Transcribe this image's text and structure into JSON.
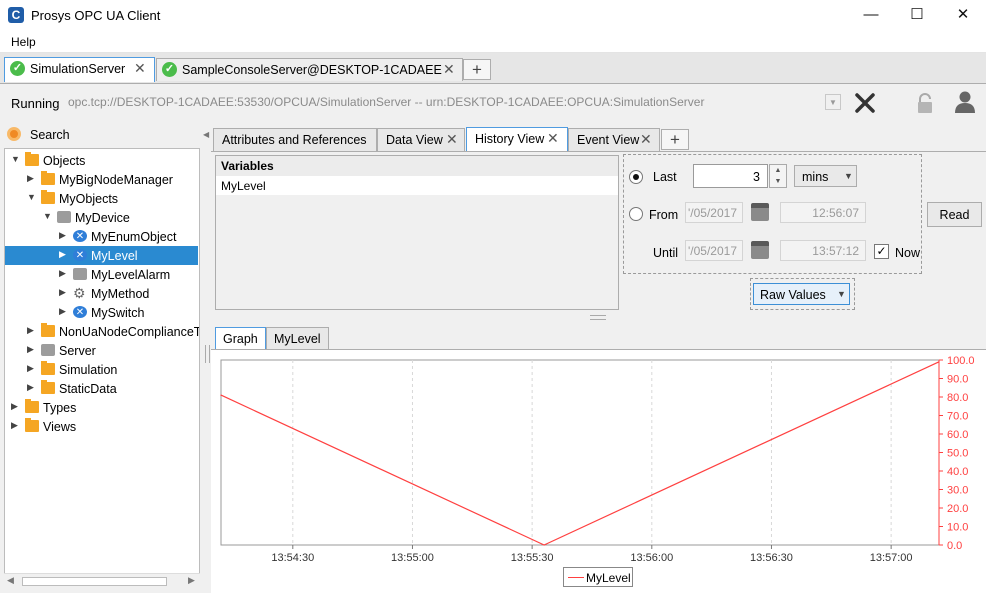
{
  "window": {
    "title": "Prosys OPC UA Client",
    "app_icon": "C",
    "minimize": "—",
    "maximize": "☐",
    "close": "✕"
  },
  "menu": {
    "help": "Help"
  },
  "server_tabs": [
    {
      "label": "SimulationServer",
      "active": true
    },
    {
      "label": "SampleConsoleServer@DESKTOP-1CADAEE",
      "active": false
    }
  ],
  "status": {
    "running": "Running",
    "url": "opc.tcp://DESKTOP-1CADAEE:53530/OPCUA/SimulationServer -- urn:DESKTOP-1CADAEE:OPCUA:SimulationServer"
  },
  "search": {
    "label": "Search"
  },
  "tree": [
    {
      "label": "Objects",
      "icon": "folder-icon",
      "arrow": "▼",
      "level": 0
    },
    {
      "label": "MyBigNodeManager",
      "icon": "folder-icon",
      "arrow": "▶",
      "level": 1
    },
    {
      "label": "MyObjects",
      "icon": "folder-icon",
      "arrow": "▼",
      "level": 1
    },
    {
      "label": "MyDevice",
      "icon": "object-icon",
      "arrow": "▼",
      "level": 2
    },
    {
      "label": "MyEnumObject",
      "icon": "variable-icon",
      "arrow": "▶",
      "level": 3
    },
    {
      "label": "MyLevel",
      "icon": "variable-icon",
      "arrow": "▶",
      "level": 3,
      "selected": true
    },
    {
      "label": "MyLevelAlarm",
      "icon": "object-icon",
      "arrow": "▶",
      "level": 3
    },
    {
      "label": "MyMethod",
      "icon": "gear-icon",
      "arrow": "▶",
      "level": 3
    },
    {
      "label": "MySwitch",
      "icon": "variable-icon",
      "arrow": "▶",
      "level": 3
    },
    {
      "label": "NonUaNodeComplianceT",
      "icon": "folder-icon",
      "arrow": "▶",
      "level": 1
    },
    {
      "label": "Server",
      "icon": "object-icon",
      "arrow": "▶",
      "level": 1
    },
    {
      "label": "Simulation",
      "icon": "folder-icon",
      "arrow": "▶",
      "level": 1
    },
    {
      "label": "StaticData",
      "icon": "folder-icon",
      "arrow": "▶",
      "level": 1
    },
    {
      "label": "Types",
      "icon": "folder-icon",
      "arrow": "▶",
      "level": 0
    },
    {
      "label": "Views",
      "icon": "folder-icon",
      "arrow": "▶",
      "level": 0
    }
  ],
  "view_tabs": [
    {
      "label": "Attributes and References",
      "closable": false
    },
    {
      "label": "Data View",
      "closable": true
    },
    {
      "label": "History View",
      "closable": true,
      "active": true
    },
    {
      "label": "Event View",
      "closable": true
    }
  ],
  "variables": {
    "header": "Variables",
    "rows": [
      "MyLevel"
    ]
  },
  "history": {
    "last_label": "Last",
    "last_value": "3",
    "unit": "mins",
    "from_label": "From",
    "from_date": "'/05/2017",
    "from_time": "12:56:07",
    "until_label": "Until",
    "until_date": "'/05/2017",
    "until_time": "13:57:12",
    "now_label": "Now",
    "read_label": "Read",
    "mode": "Raw Values"
  },
  "graph_tabs": [
    {
      "label": "Graph",
      "active": true
    },
    {
      "label": "MyLevel"
    }
  ],
  "chart_data": {
    "type": "line",
    "x_ticks": [
      "13:54:30",
      "13:55:00",
      "13:55:30",
      "13:56:00",
      "13:56:30",
      "13:57:00"
    ],
    "y_ticks": [
      "0.0",
      "10.0",
      "20.0",
      "30.0",
      "40.0",
      "50.0",
      "60.0",
      "70.0",
      "80.0",
      "90.0",
      "100.0"
    ],
    "ylim": [
      0,
      100
    ],
    "series": [
      {
        "name": "MyLevel",
        "color": "#ff4040",
        "points": [
          [
            "13:54:12",
            81
          ],
          [
            "13:55:33",
            0
          ],
          [
            "13:57:12",
            99
          ]
        ]
      }
    ],
    "legend": "bottom-center",
    "grid": true
  }
}
